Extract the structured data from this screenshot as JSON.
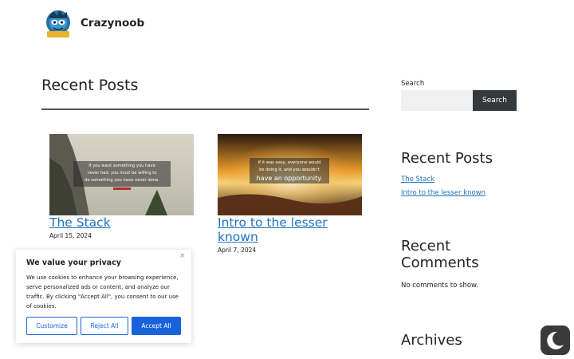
{
  "site": {
    "title": "Crazynoob",
    "logo_text": "CRAZY NOOB"
  },
  "main": {
    "heading": "Recent Posts",
    "posts": [
      {
        "title": "The Stack",
        "date": "April 15, 2024",
        "image_quote": [
          "If you want something you have",
          "never had, you must be willing to",
          "do something you have never done."
        ]
      },
      {
        "title": "Intro to the lesser known",
        "date": "April 7, 2024",
        "image_quote": [
          "If it was easy, everyone would",
          "be doing it, and you wouldn't",
          "have an opportunity."
        ]
      }
    ]
  },
  "sidebar": {
    "search": {
      "label": "Search",
      "button": "Search",
      "placeholder": ""
    },
    "recent_posts": {
      "heading": "Recent Posts",
      "items": [
        "The Stack",
        "Intro to the lesser known"
      ]
    },
    "recent_comments": {
      "heading": "Recent Comments",
      "empty": "No comments to show."
    },
    "archives": {
      "heading": "Archives"
    }
  },
  "cookie": {
    "title": "We value your privacy",
    "close": "×",
    "text": "We use cookies to enhance your browsing experience, serve personalized ads or content, and analyze our traffic. By clicking \"Accept All\", you consent to our use of cookies.",
    "customize": "Customize",
    "reject": "Reject All",
    "accept": "Accept All"
  },
  "colors": {
    "link": "#1e73be",
    "accent": "#1863dc",
    "button_dark": "#373a3c"
  },
  "icons": {
    "logo": "crazynoob-logo",
    "theme_toggle": "moon-icon",
    "close": "close-icon"
  }
}
